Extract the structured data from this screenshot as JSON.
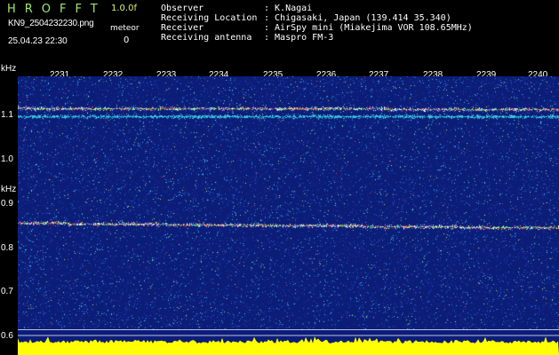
{
  "header": {
    "app_title": "HROFFT",
    "version": "1.0.0f",
    "filename": "KN9_2504232230.png",
    "datetime": "25.04.23 22:30",
    "meteor_label": "meteor",
    "meteor_count": "0"
  },
  "info": {
    "rows": [
      {
        "label": "Observer",
        "value": ": K.Nagai"
      },
      {
        "label": "Receiving Location",
        "value": ": Chigasaki, Japan (139.414 35.340)"
      },
      {
        "label": "Receiver",
        "value": ": AirSpy mini (Miakejima VOR 108.65MHz)"
      },
      {
        "label": "Receiving antenna",
        "value": ": Maspro FM-3"
      }
    ]
  },
  "axes": {
    "y_unit": "kHz",
    "y_ticks": [
      "1.1",
      "1.0",
      "0.9",
      "0.8",
      "0.7",
      "0.6"
    ],
    "x_ticks": [
      "2231",
      "2232",
      "2233",
      "2234",
      "2235",
      "2236",
      "2237",
      "2238",
      "2239",
      "2240"
    ]
  },
  "colors": {
    "background": "#0c1d78",
    "noise_colors": [
      "#1b3aa8",
      "#2a6fd6",
      "#35c7e0",
      "#7be08a",
      "#e0e040",
      "#e04a3a",
      "#c22acc",
      "#ffffff"
    ],
    "level_bar": "#ffff00",
    "band_line": "#e8e8ff",
    "signal_line": "#c8ffe8"
  },
  "spectrum": {
    "signals": [
      {
        "freq_start": 1.115,
        "freq_end": 1.112
      },
      {
        "freq_start": 1.097,
        "freq_end": 1.097
      },
      {
        "freq_start": 0.857,
        "freq_end": 0.846
      }
    ],
    "band_limits": [
      0.617,
      0.604
    ]
  }
}
